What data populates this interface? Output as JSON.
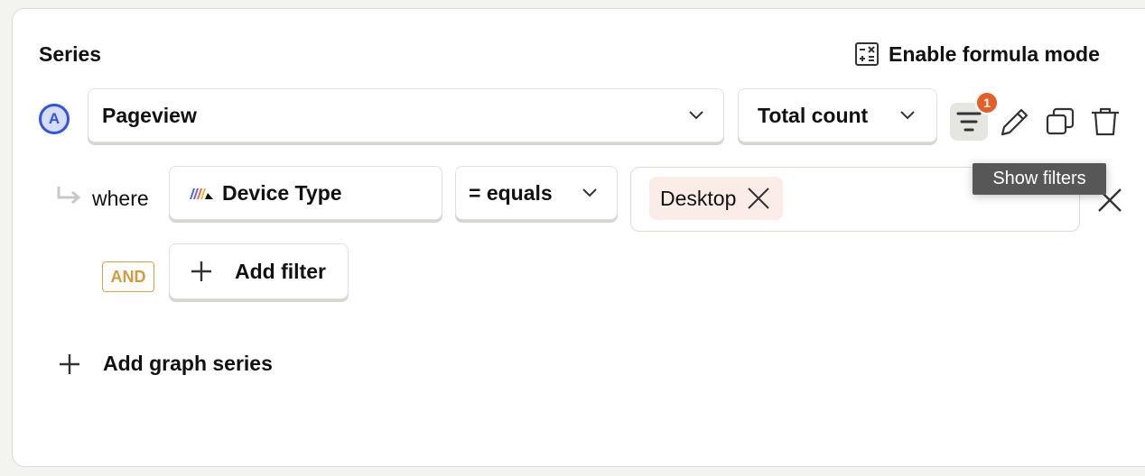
{
  "series_panel": {
    "title": "Series",
    "formula_mode_label": "Enable formula mode",
    "series": [
      {
        "letter": "A",
        "event": "Pageview",
        "aggregation": "Total count",
        "filter_count": "1",
        "filters": [
          {
            "connector": "where",
            "property": "Device Type",
            "operator": "= equals",
            "values": [
              "Desktop"
            ]
          }
        ],
        "and_label": "AND",
        "add_filter_label": "Add filter"
      }
    ],
    "tooltip": "Show filters",
    "add_series_label": "Add graph series"
  },
  "colors": {
    "series_badge": "#2f55e4",
    "notification_badge": "#e45e28",
    "and_badge": "#d49a3c",
    "value_chip_bg": "#fbece7"
  }
}
